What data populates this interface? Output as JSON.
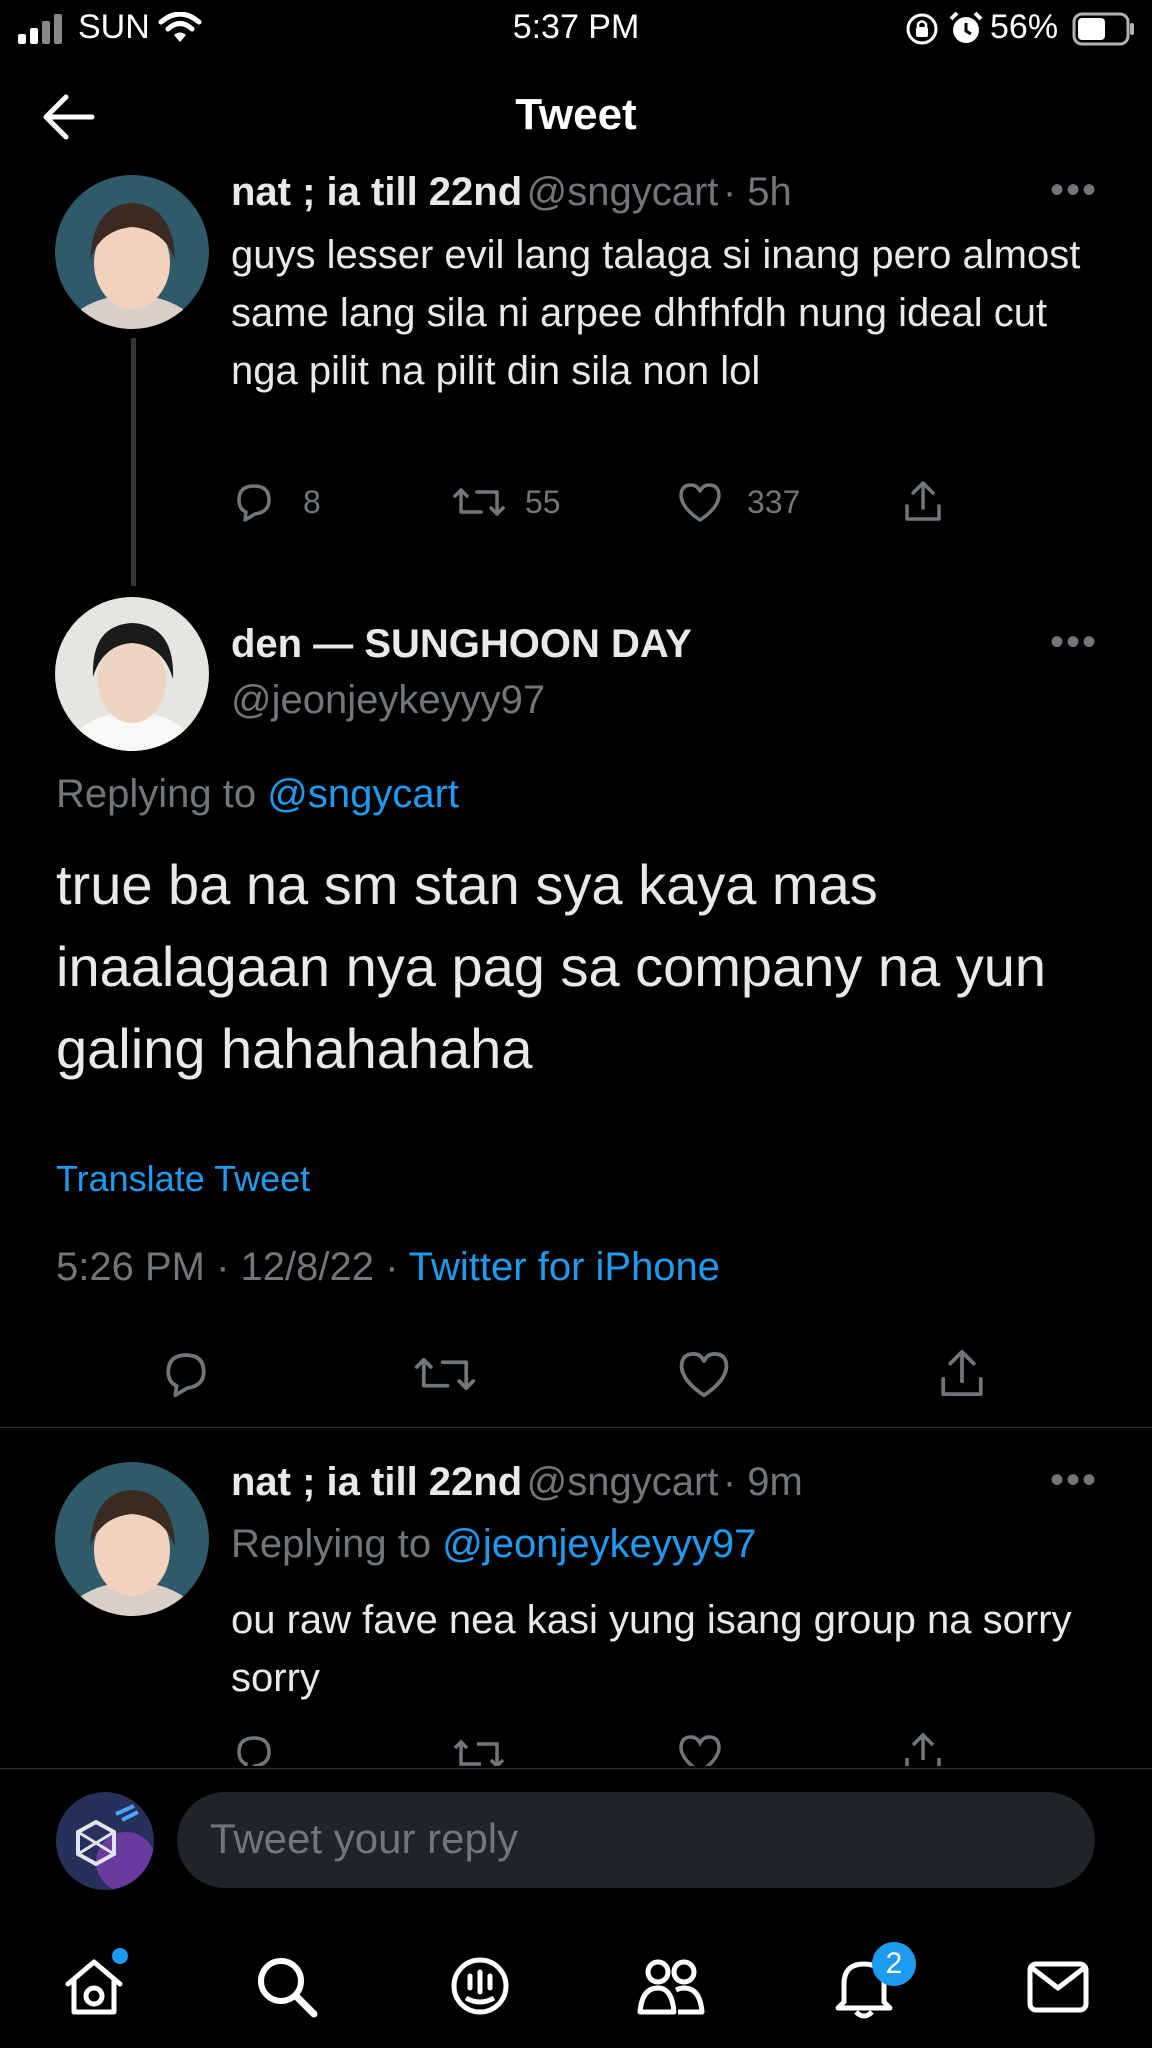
{
  "status_bar": {
    "carrier": "SUN",
    "time": "5:37 PM",
    "battery_pct": "56%"
  },
  "header": {
    "title": "Tweet"
  },
  "parent_tweet": {
    "display_name": "nat ; ia till 22nd",
    "handle": "@sngycart",
    "age": "· 5h",
    "text": "guys lesser evil lang talaga si inang pero almost same lang sila ni arpee dhfhfdh nung ideal cut nga pilit na pilit din sila non lol",
    "replies": "8",
    "retweets": "55",
    "likes": "337"
  },
  "main_tweet": {
    "display_name": "den — SUNGHOON DAY",
    "handle": "@jeonjeykeyyy97",
    "replying_prefix": "Replying to",
    "replying_to": "@sngycart",
    "text": "true ba na sm stan sya kaya mas inaalagaan nya pag sa company na yun galing hahahahaha",
    "translate_label": "Translate Tweet",
    "timestamp": "5:26 PM · 12/8/22 ·",
    "source": "Twitter for iPhone"
  },
  "reply_tweet": {
    "display_name": "nat ; ia till 22nd",
    "handle": "@sngycart",
    "age": "· 9m",
    "replying_prefix": "Replying to",
    "replying_to": "@jeonjeykeyyy97",
    "text": "ou raw fave nea kasi yung isang group na sorry sorry"
  },
  "composer": {
    "placeholder": "Tweet your reply"
  },
  "tab_bar": {
    "notifications_badge": "2"
  },
  "colors": {
    "accent": "#1d9bf0",
    "background": "#000000",
    "muted": "#71767b"
  }
}
